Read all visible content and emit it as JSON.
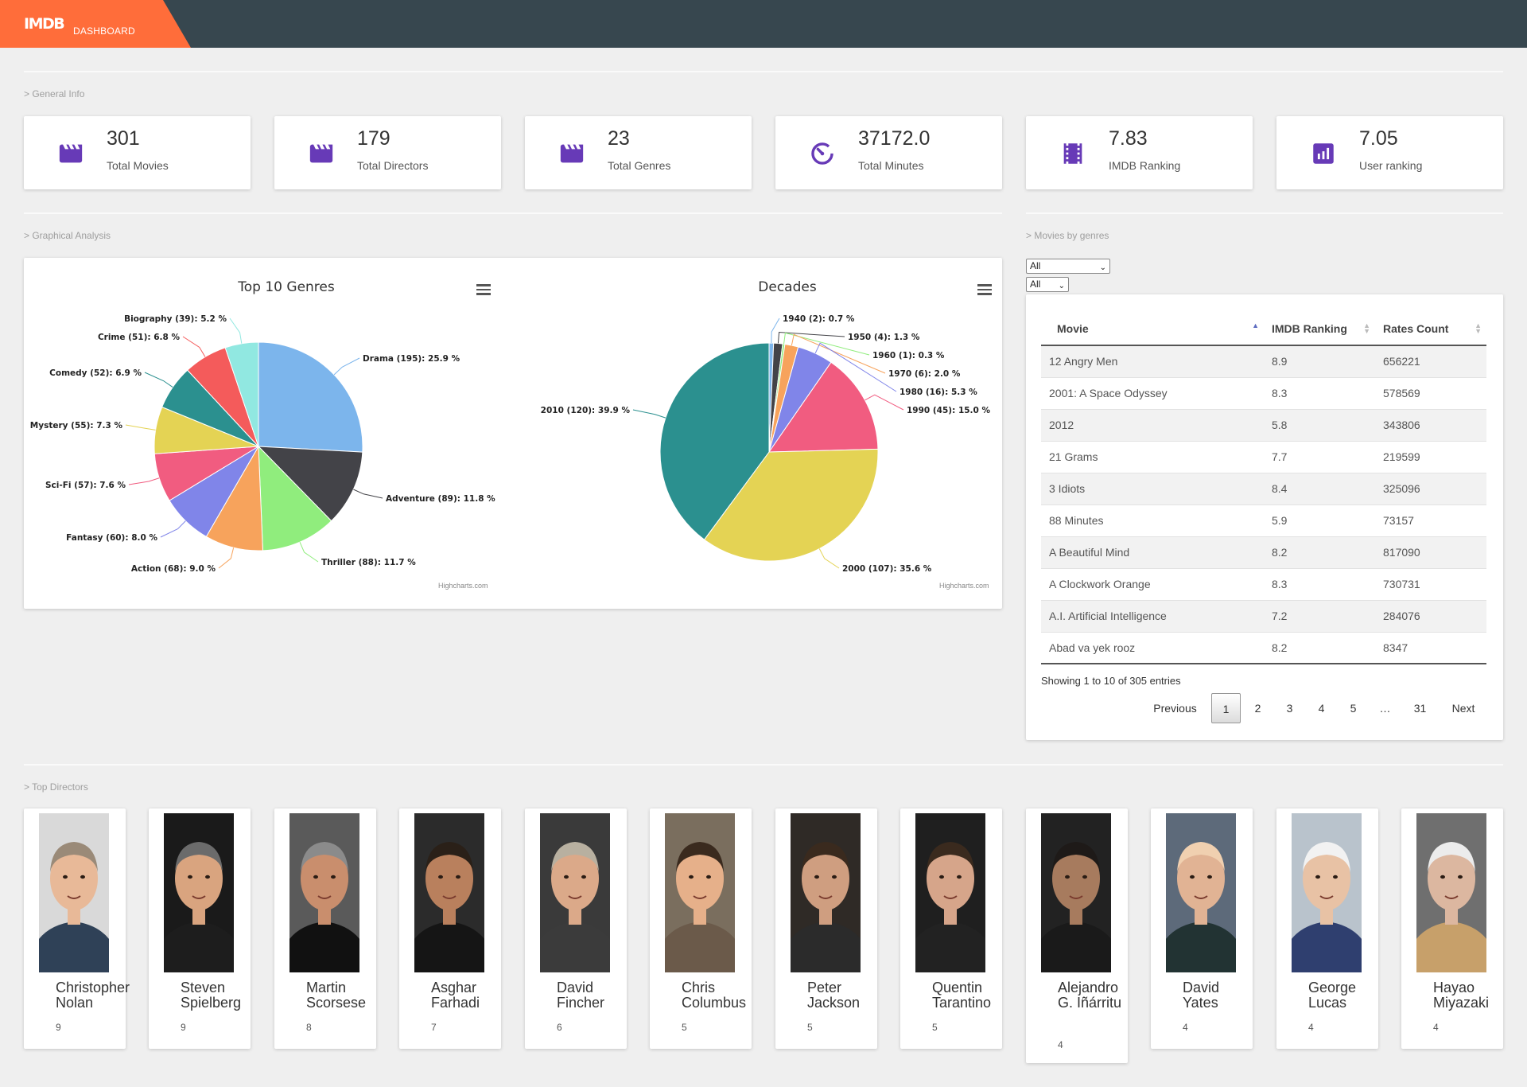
{
  "app": {
    "logo": "IMDB",
    "subtitle": "DASHBOARD"
  },
  "sections": {
    "general": "> General Info",
    "graphical": "> Graphical Analysis",
    "genres_table": "> Movies by genres",
    "directors": "> Top Directors"
  },
  "stats": [
    {
      "value": "301",
      "label": "Total Movies",
      "icon": "clapperboard-icon"
    },
    {
      "value": "179",
      "label": "Total Directors",
      "icon": "clapperboard-icon"
    },
    {
      "value": "23",
      "label": "Total Genres",
      "icon": "clapperboard-icon"
    },
    {
      "value": "37172.0",
      "label": "Total Minutes",
      "icon": "timer-icon"
    },
    {
      "value": "7.83",
      "label": "IMDB Ranking",
      "icon": "film-strip-icon"
    },
    {
      "value": "7.05",
      "label": "User ranking",
      "icon": "bar-chart-icon"
    }
  ],
  "colors": {
    "accent": "#ff6d3a",
    "topbar": "#37474f",
    "icon": "#673ab7"
  },
  "chart_data": [
    {
      "type": "pie",
      "title": "Top 10 Genres",
      "credit": "Highcharts.com",
      "labels": [
        "Drama",
        "Adventure",
        "Thriller",
        "Action",
        "Fantasy",
        "Sci-Fi",
        "Mystery",
        "Comedy",
        "Crime",
        "Biography"
      ],
      "values": [
        195,
        89,
        88,
        68,
        60,
        57,
        55,
        52,
        51,
        39
      ],
      "percents": [
        25.9,
        11.8,
        11.7,
        9.0,
        8.0,
        7.6,
        7.3,
        6.9,
        6.8,
        5.2
      ],
      "colors": [
        "#7cb5ec",
        "#434348",
        "#90ed7d",
        "#f7a35c",
        "#8085e9",
        "#f15c80",
        "#e4d354",
        "#2b908f",
        "#f45b5b",
        "#91e8e1"
      ],
      "data_labels": [
        "Drama (195): 25.9 %",
        "Adventure (89): 11.8 %",
        "Thriller (88): 11.7 %",
        "Action (68): 9.0 %",
        "Fantasy (60): 8.0 %",
        "Sci-Fi (57): 7.6 %",
        "Mystery (55): 7.3 %",
        "Comedy (52): 6.9 %",
        "Crime (51): 6.8 %",
        "Biography (39): 5.2 %"
      ]
    },
    {
      "type": "pie",
      "title": "Decades",
      "credit": "Highcharts.com",
      "labels": [
        "1940",
        "1950",
        "1960",
        "1970",
        "1980",
        "1990",
        "2000",
        "2010"
      ],
      "values": [
        2,
        4,
        1,
        6,
        16,
        45,
        107,
        120
      ],
      "percents": [
        0.7,
        1.3,
        0.3,
        2.0,
        5.3,
        15.0,
        35.6,
        39.9
      ],
      "colors": [
        "#7cb5ec",
        "#434348",
        "#90ed7d",
        "#f7a35c",
        "#8085e9",
        "#f15c80",
        "#e4d354",
        "#2b908f"
      ],
      "data_labels": [
        "1940 (2): 0.7 %",
        "1950 (4): 1.3 %",
        "1960 (1): 0.3 %",
        "1970 (6): 2.0 %",
        "1980 (16): 5.3 %",
        "1990 (45): 15.0 %",
        "2000 (107): 35.6 %",
        "2010 (120): 39.9 %"
      ]
    }
  ],
  "filters": {
    "genre": "All",
    "decade": "All"
  },
  "table": {
    "headers": [
      "Movie",
      "IMDB Ranking",
      "Rates Count"
    ],
    "rows": [
      [
        "12 Angry Men",
        "8.9",
        "656221"
      ],
      [
        "2001: A Space Odyssey",
        "8.3",
        "578569"
      ],
      [
        "2012",
        "5.8",
        "343806"
      ],
      [
        "21 Grams",
        "7.7",
        "219599"
      ],
      [
        "3 Idiots",
        "8.4",
        "325096"
      ],
      [
        "88 Minutes",
        "5.9",
        "73157"
      ],
      [
        "A Beautiful Mind",
        "8.2",
        "817090"
      ],
      [
        "A Clockwork Orange",
        "8.3",
        "730731"
      ],
      [
        "A.I. Artificial Intelligence",
        "7.2",
        "284076"
      ],
      [
        "Abad va yek rooz",
        "8.2",
        "8347"
      ]
    ],
    "info": "Showing 1 to 10 of 305 entries",
    "pagination": {
      "previous": "Previous",
      "pages": [
        "1",
        "2",
        "3",
        "4",
        "5",
        "…",
        "31"
      ],
      "next": "Next",
      "current": "1"
    }
  },
  "directors": [
    {
      "name": "Christopher Nolan",
      "count": "9"
    },
    {
      "name": "Steven Spielberg",
      "count": "9"
    },
    {
      "name": "Martin Scorsese",
      "count": "8"
    },
    {
      "name": "Asghar Farhadi",
      "count": "7"
    },
    {
      "name": "David Fincher",
      "count": "6"
    },
    {
      "name": "Chris Columbus",
      "count": "5"
    },
    {
      "name": "Peter Jackson",
      "count": "5"
    },
    {
      "name": "Quentin Tarantino",
      "count": "5"
    },
    {
      "name": "Alejandro G. Iñárritu",
      "count": "4"
    },
    {
      "name": "David Yates",
      "count": "4"
    },
    {
      "name": "George Lucas",
      "count": "4"
    },
    {
      "name": "Hayao Miyazaki",
      "count": "4"
    }
  ]
}
